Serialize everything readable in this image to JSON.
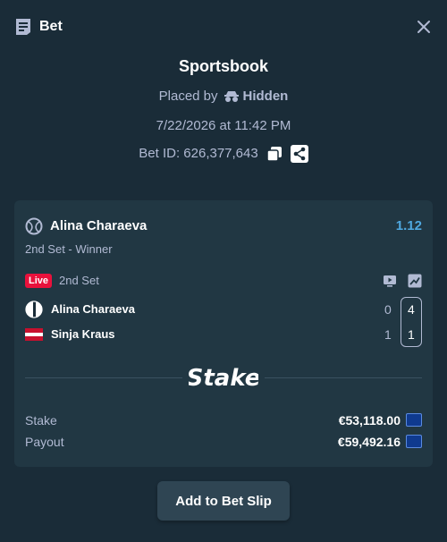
{
  "header": {
    "title": "Bet"
  },
  "bet": {
    "title": "Sportsbook",
    "placed_by_label": "Placed by",
    "placed_by_user": "Hidden",
    "datetime": "7/22/2026 at 11:42 PM",
    "bet_id": "Bet ID: 626,377,643"
  },
  "selection": {
    "name": "Alina Charaeva",
    "odds": "1.12",
    "market": "2nd Set - Winner"
  },
  "event": {
    "live_label": "Live",
    "period": "2nd Set",
    "teams": [
      {
        "name": "Alina Charaeva",
        "sets": "0",
        "games": "4"
      },
      {
        "name": "Sinja Kraus",
        "sets": "1",
        "games": "1"
      }
    ]
  },
  "logo_text": "Stake",
  "amounts": {
    "stake_label": "Stake",
    "stake_value": "€53,118.00",
    "payout_label": "Payout",
    "payout_value": "€59,492.16"
  },
  "actions": {
    "add_label": "Add to Bet Slip"
  },
  "colors": {
    "background": "#1a2c38",
    "card": "#213743",
    "odds": "#4fa8e0",
    "live": "#e9113c"
  }
}
